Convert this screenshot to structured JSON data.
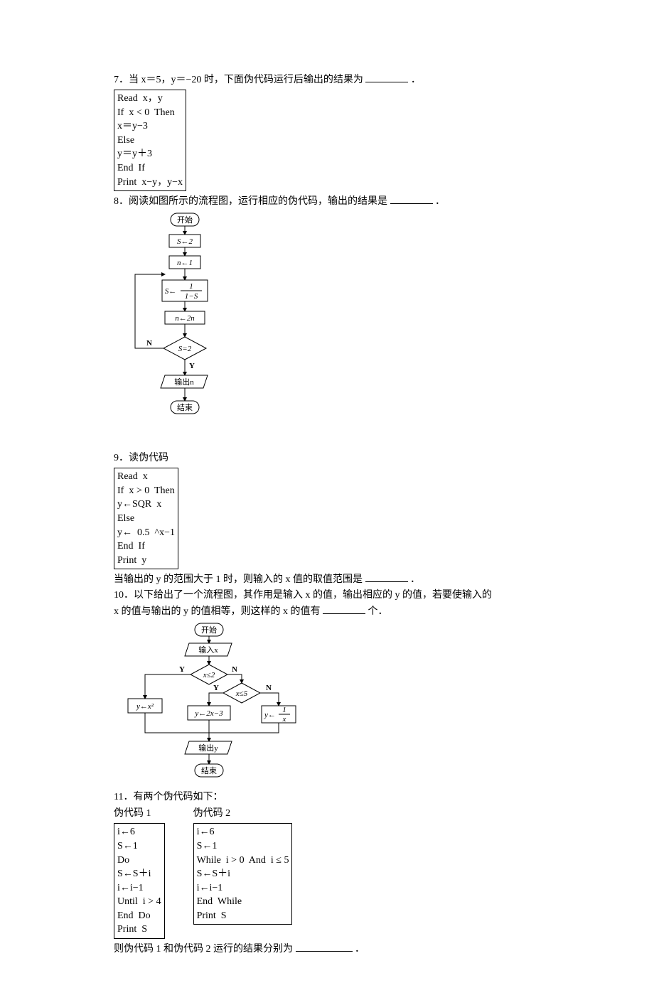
{
  "q7": {
    "prompt": "7．当 x＝5，y＝−20 时，下面伪代码运行后输出的结果为",
    "tail": "．",
    "code": "Read  x，y\nIf  x < 0  Then\nx＝y−3\nElse\ny＝y＋3\nEnd  If\nPrint  x−y，y−x"
  },
  "q8": {
    "prompt": "8．阅读如图所示的流程图，运行相应的伪代码，输出的结果是",
    "tail": "．",
    "fc": {
      "start": "开始",
      "s2": "S←2",
      "n1": "n←1",
      "sfrac_top": "1",
      "sfrac_bot": "1−S",
      "sfrac_pref": "S←",
      "n2n": "n←2n",
      "cond": "S=2",
      "yes": "Y",
      "no": "N",
      "out": "输出n",
      "end": "结束"
    }
  },
  "q9": {
    "title": "9．读伪代码",
    "code": "Read  x\nIf  x > 0  Then\ny←SQR  x\nElse\ny←  0.5  ^x−1\nEnd  If\nPrint  y",
    "prompt": "当输出的 y 的范围大于 1 时，则输入的 x 值的取值范围是",
    "tail": "．"
  },
  "q10": {
    "prompt_a": "10．以下给出了一个流程图，其作用是输入 x 的值，输出相应的 y 的值，若要使输入的",
    "prompt_b": "x 的值与输出的 y 的值相等，则这样的 x 的值有",
    "tail": "个．",
    "fc": {
      "start": "开始",
      "in": "输入x",
      "c1": "x≤2",
      "c2": "x≤5",
      "yes": "Y",
      "no": "N",
      "b1": "y←x²",
      "b2": "y←2x−3",
      "b3_pref": "y←",
      "b3_top": "1",
      "b3_bot": "x",
      "out": "输出y",
      "end": "结束"
    }
  },
  "q11": {
    "title": "11．有两个伪代码如下：",
    "h1": "伪代码 1",
    "h2": "伪代码 2",
    "code1": "i←6\nS←1\nDo\nS←S＋i\ni←i−1\nUntil  i > 4\nEnd  Do\nPrint  S",
    "code2": "i←6\nS←1\nWhile  i > 0  And  i ≤ 5\nS←S＋i\ni←i−1\nEnd  While\nPrint  S",
    "prompt": "则伪代码 1 和伪代码 2 运行的结果分别为",
    "tail": "．"
  }
}
